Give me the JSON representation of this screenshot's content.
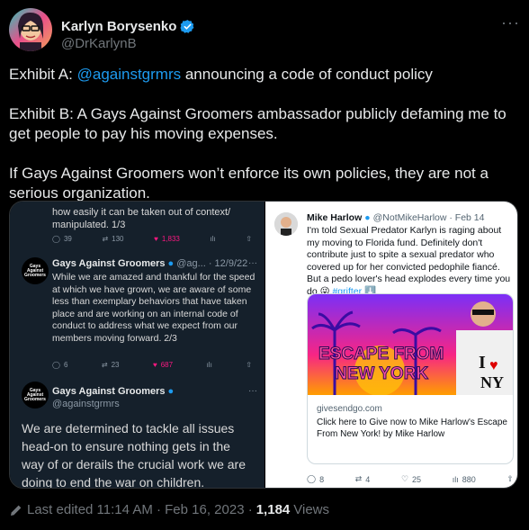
{
  "author": {
    "name": "Karlyn Borysenko",
    "handle": "@DrKarlynB",
    "verified_color": "#1d9bf0"
  },
  "tweet": {
    "line1_prefix": "Exhibit A: ",
    "line1_mention": "@againstgrmrs",
    "line1_suffix": "  announcing a code of conduct policy",
    "paragraph2": "Exhibit B: A Gays Against Groomers ambassador publicly defaming me to get people to pay his moving expenses.",
    "paragraph3": "If Gays Against Groomers won’t enforce its own policies, they are not a serious organization."
  },
  "left_screenshot": {
    "top_text": "how easily it can be taken out of context/ manipulated. 1/3",
    "stats1": {
      "replies": "39",
      "retweets": "130",
      "likes": "1,833"
    },
    "tweet2": {
      "name": "Gays Against Groomers",
      "sub": "@ag... · 12/9/22",
      "logo_text": "Gays Against Groomers",
      "body": "While we are amazed and thankful for the speed at which we have grown, we are aware of some less than exemplary behaviors that have taken place and are working on an internal code of conduct to address what we expect from our members moving forward. 2/3"
    },
    "stats2": {
      "replies": "6",
      "retweets": "23",
      "likes": "687"
    },
    "tweet3": {
      "name": "Gays Against Groomers",
      "handle": "@againstgrmrs",
      "logo_text": "Gays Against Groomers",
      "body": "We are determined to tackle all issues head-on to ensure nothing gets in the way of or derails the crucial work we are doing to end the war on children."
    }
  },
  "right_screenshot": {
    "name": "Mike Harlow",
    "handle": "@NotMikeHarlow · Feb 14",
    "text": "I'm told Sexual Predator Karlyn is raging about my moving to Florida fund. Definitely don't contribute just to spite a sexual predator who covered up for her convicted pedophile fiancé. But a pedo lover's head explodes every time you do 😜 ",
    "hashtag": "#grifter ⬇️",
    "card": {
      "image_text_line1": "ESCAPE FROM",
      "image_text_line2": "NEW YORK",
      "shirt_text": "I ❤ NY",
      "domain": "givesendgo.com",
      "title": "Click here to Give now to Mike Harlow's Escape From New York! by Mike Harlow"
    },
    "stats": {
      "replies": "8",
      "retweets": "4",
      "likes": "25",
      "views": "880"
    }
  },
  "footer": {
    "edited": "Last edited 11:14 AM · Feb 16, 2023 · ",
    "views_count": "1,184",
    "views_label": " Views"
  }
}
